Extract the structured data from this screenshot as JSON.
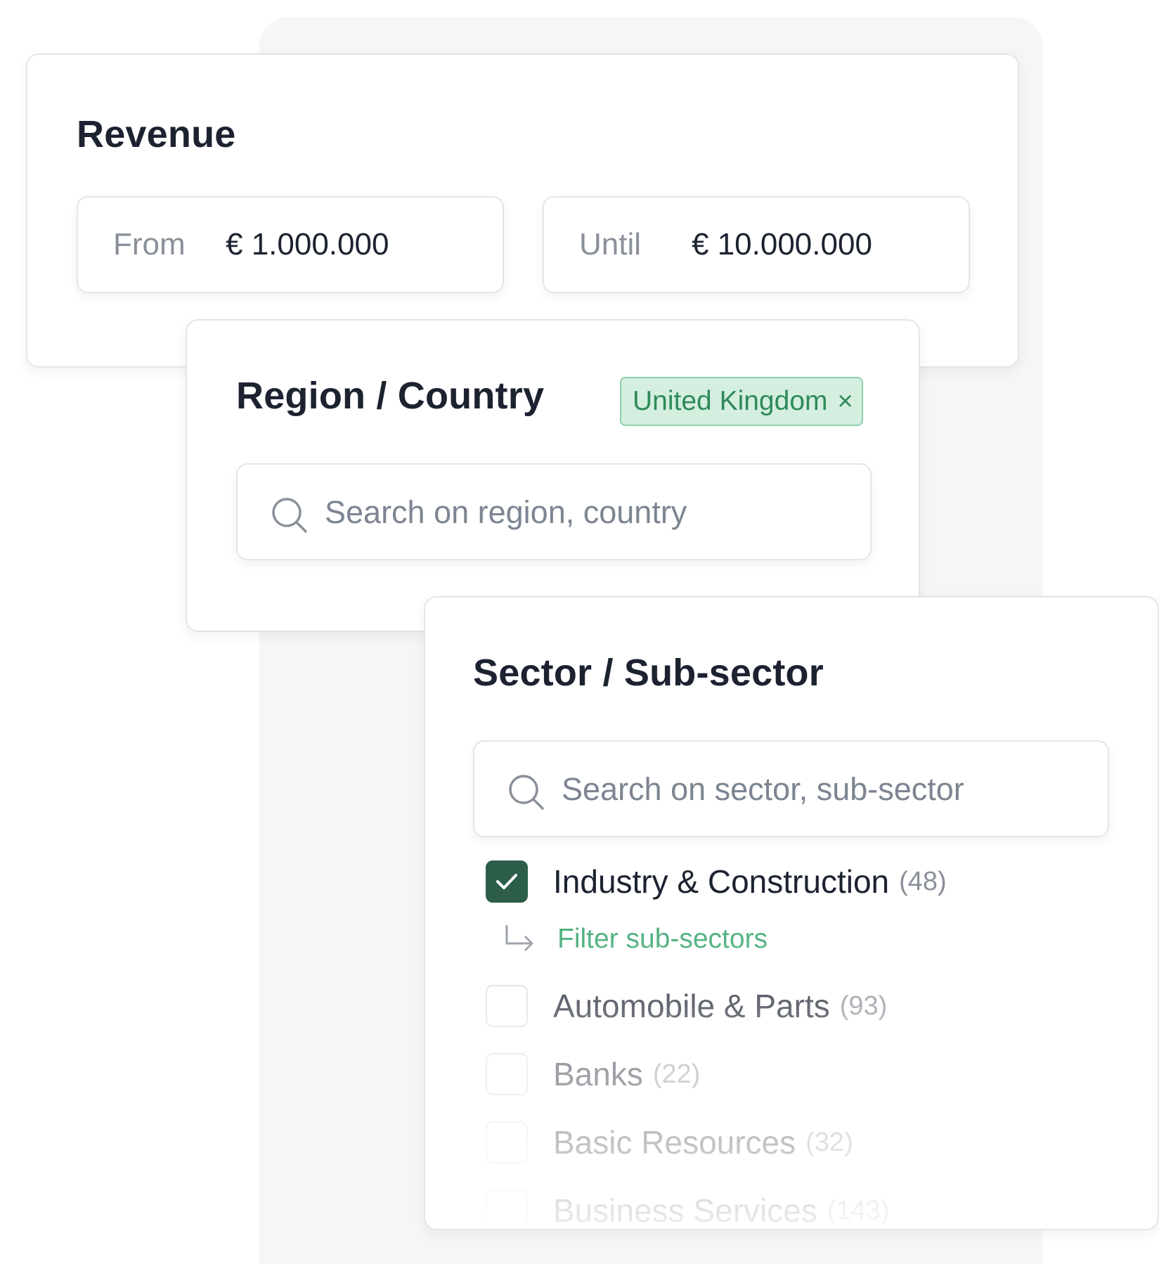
{
  "revenue": {
    "title": "Revenue",
    "from_label": "From",
    "from_value": "€ 1.000.000",
    "until_label": "Until",
    "until_value": "€ 10.000.000"
  },
  "region": {
    "title": "Region / Country",
    "selected_tag": "United Kingdom",
    "tag_remove_glyph": "×",
    "search_placeholder": "Search on region, country"
  },
  "sector": {
    "title": "Sector / Sub-sector",
    "search_placeholder": "Search on sector, sub-sector",
    "filter_subsectors_label": "Filter sub-sectors",
    "items": [
      {
        "label": "Industry & Construction",
        "count": "(48)",
        "checked": true
      },
      {
        "label": "Automobile & Parts",
        "count": "(93)",
        "checked": false
      },
      {
        "label": "Banks",
        "count": "(22)",
        "checked": false
      },
      {
        "label": "Basic Resources",
        "count": "(32)",
        "checked": false
      },
      {
        "label": "Business Services",
        "count": "(143)",
        "checked": false
      }
    ]
  },
  "colors": {
    "accent_green": "#2c5e4a",
    "tag_bg": "#d4eedf",
    "tag_text": "#2e8a59",
    "link_green": "#4caf7d"
  },
  "icons": {
    "search": "search-icon",
    "check": "check-icon",
    "subdirectory_arrow": "subdirectory-arrow-icon",
    "close": "close-icon"
  }
}
